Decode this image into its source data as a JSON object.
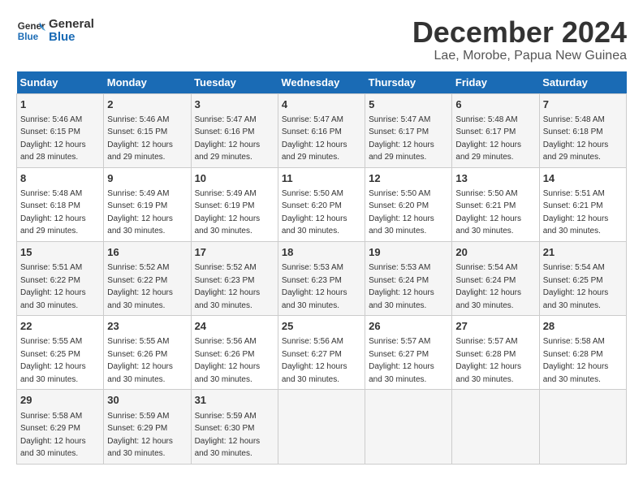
{
  "logo": {
    "line1": "General",
    "line2": "Blue"
  },
  "title": "December 2024",
  "location": "Lae, Morobe, Papua New Guinea",
  "days_of_week": [
    "Sunday",
    "Monday",
    "Tuesday",
    "Wednesday",
    "Thursday",
    "Friday",
    "Saturday"
  ],
  "weeks": [
    [
      {
        "day": "1",
        "sunrise": "5:46 AM",
        "sunset": "6:15 PM",
        "daylight": "12 hours and 28 minutes."
      },
      {
        "day": "2",
        "sunrise": "5:46 AM",
        "sunset": "6:15 PM",
        "daylight": "12 hours and 29 minutes."
      },
      {
        "day": "3",
        "sunrise": "5:47 AM",
        "sunset": "6:16 PM",
        "daylight": "12 hours and 29 minutes."
      },
      {
        "day": "4",
        "sunrise": "5:47 AM",
        "sunset": "6:16 PM",
        "daylight": "12 hours and 29 minutes."
      },
      {
        "day": "5",
        "sunrise": "5:47 AM",
        "sunset": "6:17 PM",
        "daylight": "12 hours and 29 minutes."
      },
      {
        "day": "6",
        "sunrise": "5:48 AM",
        "sunset": "6:17 PM",
        "daylight": "12 hours and 29 minutes."
      },
      {
        "day": "7",
        "sunrise": "5:48 AM",
        "sunset": "6:18 PM",
        "daylight": "12 hours and 29 minutes."
      }
    ],
    [
      {
        "day": "8",
        "sunrise": "5:48 AM",
        "sunset": "6:18 PM",
        "daylight": "12 hours and 29 minutes."
      },
      {
        "day": "9",
        "sunrise": "5:49 AM",
        "sunset": "6:19 PM",
        "daylight": "12 hours and 30 minutes."
      },
      {
        "day": "10",
        "sunrise": "5:49 AM",
        "sunset": "6:19 PM",
        "daylight": "12 hours and 30 minutes."
      },
      {
        "day": "11",
        "sunrise": "5:50 AM",
        "sunset": "6:20 PM",
        "daylight": "12 hours and 30 minutes."
      },
      {
        "day": "12",
        "sunrise": "5:50 AM",
        "sunset": "6:20 PM",
        "daylight": "12 hours and 30 minutes."
      },
      {
        "day": "13",
        "sunrise": "5:50 AM",
        "sunset": "6:21 PM",
        "daylight": "12 hours and 30 minutes."
      },
      {
        "day": "14",
        "sunrise": "5:51 AM",
        "sunset": "6:21 PM",
        "daylight": "12 hours and 30 minutes."
      }
    ],
    [
      {
        "day": "15",
        "sunrise": "5:51 AM",
        "sunset": "6:22 PM",
        "daylight": "12 hours and 30 minutes."
      },
      {
        "day": "16",
        "sunrise": "5:52 AM",
        "sunset": "6:22 PM",
        "daylight": "12 hours and 30 minutes."
      },
      {
        "day": "17",
        "sunrise": "5:52 AM",
        "sunset": "6:23 PM",
        "daylight": "12 hours and 30 minutes."
      },
      {
        "day": "18",
        "sunrise": "5:53 AM",
        "sunset": "6:23 PM",
        "daylight": "12 hours and 30 minutes."
      },
      {
        "day": "19",
        "sunrise": "5:53 AM",
        "sunset": "6:24 PM",
        "daylight": "12 hours and 30 minutes."
      },
      {
        "day": "20",
        "sunrise": "5:54 AM",
        "sunset": "6:24 PM",
        "daylight": "12 hours and 30 minutes."
      },
      {
        "day": "21",
        "sunrise": "5:54 AM",
        "sunset": "6:25 PM",
        "daylight": "12 hours and 30 minutes."
      }
    ],
    [
      {
        "day": "22",
        "sunrise": "5:55 AM",
        "sunset": "6:25 PM",
        "daylight": "12 hours and 30 minutes."
      },
      {
        "day": "23",
        "sunrise": "5:55 AM",
        "sunset": "6:26 PM",
        "daylight": "12 hours and 30 minutes."
      },
      {
        "day": "24",
        "sunrise": "5:56 AM",
        "sunset": "6:26 PM",
        "daylight": "12 hours and 30 minutes."
      },
      {
        "day": "25",
        "sunrise": "5:56 AM",
        "sunset": "6:27 PM",
        "daylight": "12 hours and 30 minutes."
      },
      {
        "day": "26",
        "sunrise": "5:57 AM",
        "sunset": "6:27 PM",
        "daylight": "12 hours and 30 minutes."
      },
      {
        "day": "27",
        "sunrise": "5:57 AM",
        "sunset": "6:28 PM",
        "daylight": "12 hours and 30 minutes."
      },
      {
        "day": "28",
        "sunrise": "5:58 AM",
        "sunset": "6:28 PM",
        "daylight": "12 hours and 30 minutes."
      }
    ],
    [
      {
        "day": "29",
        "sunrise": "5:58 AM",
        "sunset": "6:29 PM",
        "daylight": "12 hours and 30 minutes."
      },
      {
        "day": "30",
        "sunrise": "5:59 AM",
        "sunset": "6:29 PM",
        "daylight": "12 hours and 30 minutes."
      },
      {
        "day": "31",
        "sunrise": "5:59 AM",
        "sunset": "6:30 PM",
        "daylight": "12 hours and 30 minutes."
      },
      null,
      null,
      null,
      null
    ]
  ]
}
